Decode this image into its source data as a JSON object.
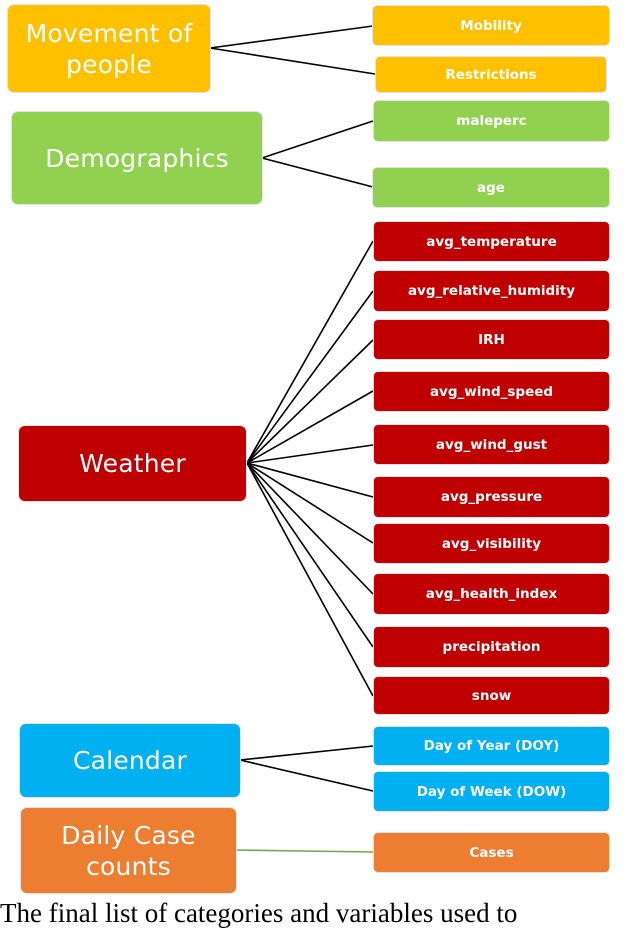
{
  "colors": {
    "movement": "#FFC000",
    "demographics": "#92D050",
    "weather": "#C00000",
    "calendar": "#00B0F0",
    "cases": "#ED7D31",
    "connector": "#000000",
    "cases_connector": "#70AD47"
  },
  "categories": [
    {
      "id": "movement",
      "label": "Movement of people",
      "variables": [
        "Mobility",
        "Restrictions"
      ]
    },
    {
      "id": "demographics",
      "label": "Demographics",
      "variables": [
        "maleperc",
        "age"
      ]
    },
    {
      "id": "weather",
      "label": "Weather",
      "variables": [
        "avg_temperature",
        "avg_relative_humidity",
        "IRH",
        "avg_wind_speed",
        "avg_wind_gust",
        "avg_pressure",
        "avg_visibility",
        "avg_health_index",
        "precipitation",
        "snow"
      ]
    },
    {
      "id": "calendar",
      "label": "Calendar",
      "variables": [
        "Day of Year (DOY)",
        "Day of Week (DOW)"
      ]
    },
    {
      "id": "cases",
      "label": "Daily Case counts",
      "variables": [
        "Cases"
      ]
    }
  ],
  "labels": {
    "movement_line1": "Movement of",
    "movement_line2": "people",
    "demographics": "Demographics",
    "weather": "Weather",
    "calendar": "Calendar",
    "cases_line1": "Daily Case",
    "cases_line2": "counts"
  },
  "variables": {
    "mobility": "Mobility",
    "restrictions": "Restrictions",
    "maleperc": "maleperc",
    "age": "age",
    "avg_temperature": "avg_temperature",
    "avg_relative_humidity": "avg_relative_humidity",
    "irh": "IRH",
    "avg_wind_speed": "avg_wind_speed",
    "avg_wind_gust": "avg_wind_gust",
    "avg_pressure": "avg_pressure",
    "avg_visibility": "avg_visibility",
    "avg_health_index": "avg_health_index",
    "precipitation": "precipitation",
    "snow": "snow",
    "doy": "Day of Year (DOY)",
    "dow": "Day of Week (DOW)",
    "cases": "Cases"
  },
  "caption": "The final list of categories and variables used to"
}
